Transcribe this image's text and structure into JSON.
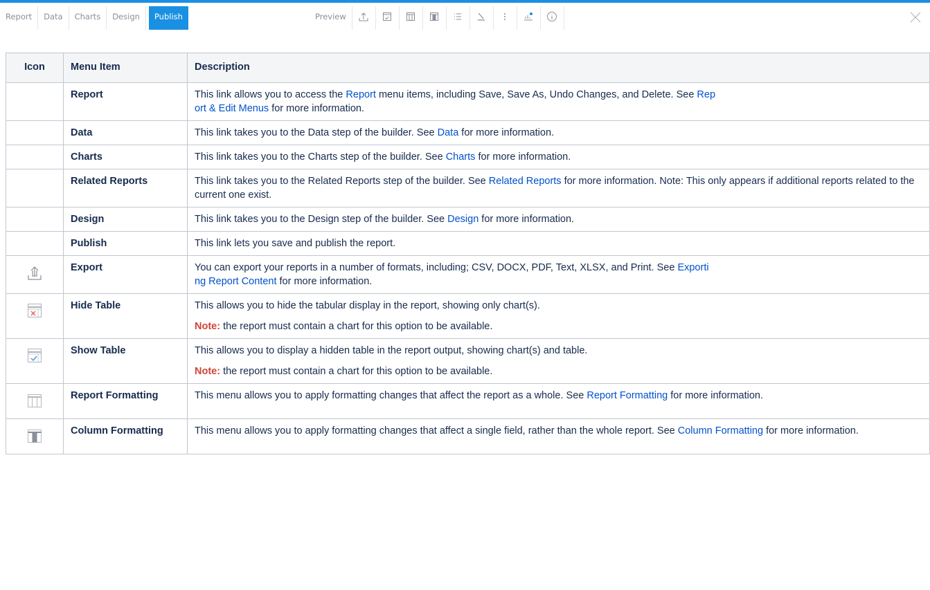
{
  "toolbar": {
    "tabs": [
      {
        "label": "Report",
        "active": false
      },
      {
        "label": "Data",
        "active": false
      },
      {
        "label": "Charts",
        "active": false
      },
      {
        "label": "Design",
        "active": false
      },
      {
        "label": "Publish",
        "active": true
      }
    ],
    "preview_label": "Preview",
    "tools": [
      "export-icon",
      "show-table-icon",
      "report-formatting-icon",
      "column-formatting-icon",
      "list-icon",
      "brush-icon",
      "more-icon",
      "chart-icon",
      "info-icon"
    ],
    "accent_color": "#1a90e2"
  },
  "table": {
    "headers": [
      "Icon",
      "Menu Item",
      "Description"
    ],
    "rows": [
      {
        "icon": "",
        "item": "Report",
        "desc": {
          "t1": "This link allows you to access the ",
          "l1": "Report",
          "t2": " menu items, including Save, Save As, Undo Changes, and Delete. See ",
          "l2a": "Rep",
          "l2b": "ort & Edit Menus",
          "t3": " for more information."
        }
      },
      {
        "icon": "",
        "item": "Data",
        "desc": {
          "t1": "This link takes you to the Data step of the builder. See ",
          "l1": "Data",
          "t2": " for more information."
        }
      },
      {
        "icon": "",
        "item": "Charts",
        "desc": {
          "t1": "This link takes you to the Charts step of the builder. See ",
          "l1": "Charts",
          "t2": " for more information."
        }
      },
      {
        "icon": "",
        "item": "Related Reports",
        "desc": {
          "t1": "This link takes you to the Related Reports step of the builder. See ",
          "l1": "Related Reports",
          "t2": " for more information. Note: This only appears if additional reports related to the current one exist."
        }
      },
      {
        "icon": "",
        "item": "Design",
        "desc": {
          "t1": "This link takes you to the Design step of the builder. See ",
          "l1": "Design",
          "t2": " for more information."
        }
      },
      {
        "icon": "",
        "item": "Publish",
        "desc": {
          "t1": "This link lets you save and publish the report."
        }
      },
      {
        "icon": "export-icon",
        "item": "Export",
        "desc": {
          "t1": "You can export your reports in a number of formats, including; CSV, DOCX, PDF, Text, XLSX, and Print. See ",
          "l1a": "Exporti",
          "l1b": "ng Report Content",
          "t2": " for more information."
        }
      },
      {
        "icon": "hide-table-icon",
        "item": "Hide Table",
        "desc": {
          "t1": "This allows you to hide the tabular display in the report, showing only chart(s).",
          "note": "Note:",
          "note_text": " the report must contain a chart for this option to be available."
        }
      },
      {
        "icon": "show-table-icon",
        "item": "Show Table",
        "desc": {
          "t1": "This allows you to display a hidden table in the report output, showing chart(s) and table.",
          "note": "Note:",
          "note_text": " the report must contain a chart for this option to be available."
        }
      },
      {
        "icon": "report-formatting-icon",
        "item": "Report Formatting",
        "desc": {
          "t1": "This menu allows you to apply formatting changes that affect the report as a whole. See ",
          "l1": "Report Formatting",
          "t2": " for more information."
        }
      },
      {
        "icon": "column-formatting-icon",
        "item": "Column Formatting",
        "desc": {
          "t1": "This menu allows you to apply formatting changes that affect a single field, rather than the whole report. See ",
          "l1": "Column Formatting",
          "t2": " for more information."
        }
      }
    ],
    "link_color": "#0052cc",
    "note_color": "#d04437"
  }
}
